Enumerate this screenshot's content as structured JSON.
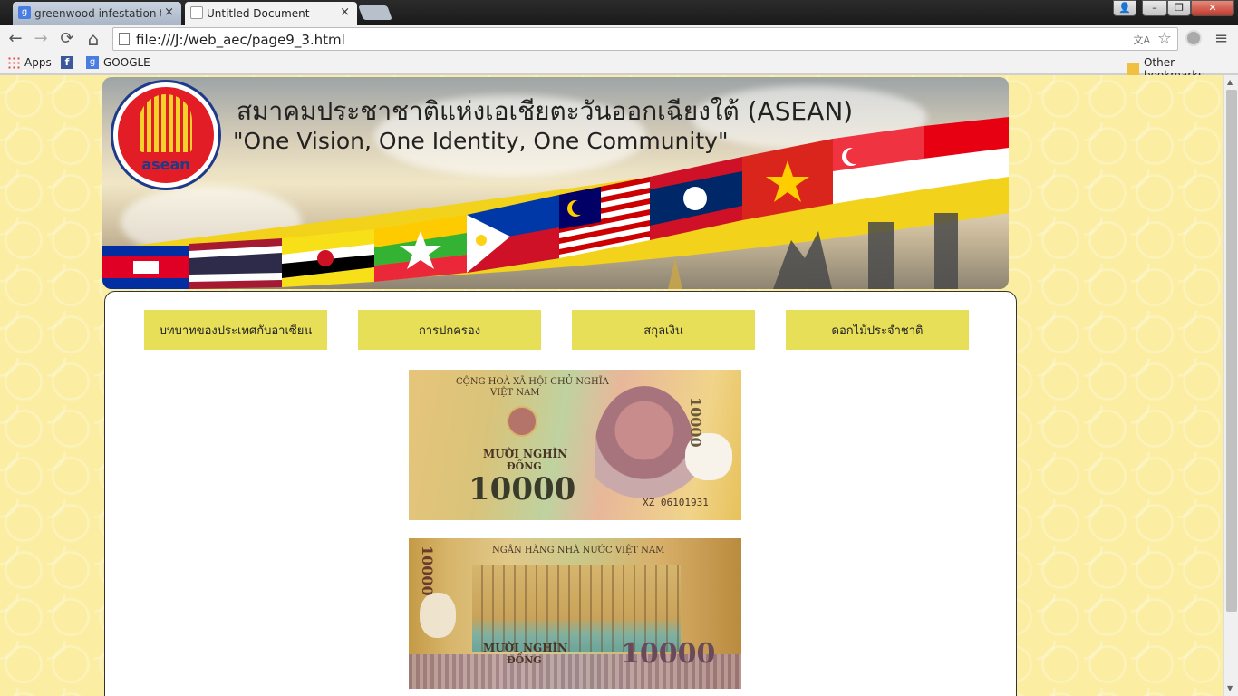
{
  "browser": {
    "tabs": [
      {
        "label": "greenwood infestation th",
        "active": false
      },
      {
        "label": "Untitled Document",
        "active": true
      }
    ],
    "close_glyph": "×",
    "url": "file:///J:/web_aec/page9_3.html",
    "bookmarks": [
      {
        "label": "Apps",
        "icon": "apps-icon"
      },
      {
        "label": "GOOGLE",
        "icon": "google-icon"
      }
    ],
    "other_bookmarks": "Other bookmarks",
    "icons": {
      "back": "←",
      "forward": "→",
      "reload": "⟳",
      "home": "⌂",
      "star": "☆",
      "menu": "≡"
    }
  },
  "banner": {
    "logo_word": "asean",
    "title": "สมาคมประชาชาติแห่งเอเชียตะวันออกเฉียงใต้ (ASEAN)",
    "slogan": "\"One Vision, One Identity, One Community\""
  },
  "menu": [
    {
      "label": "บทบาทของประเทศกับอาเซียน"
    },
    {
      "label": "การปกครอง"
    },
    {
      "label": "สกุลเงิน"
    },
    {
      "label": "ดอกไม้ประจำชาติ"
    }
  ],
  "banknote_front": {
    "header_1": "CỘNG HOÀ XÃ HỘI CHỦ NGHĨA",
    "header_2": "VIỆT NAM",
    "words_1": "MƯỜI NGHÌN",
    "words_2": "ĐỒNG",
    "value": "10000",
    "serial": "XZ 06101931"
  },
  "banknote_back": {
    "header": "NGÂN HÀNG NHÀ NƯỚC VIỆT NAM",
    "words_1": "MƯỜI NGHÌN",
    "words_2": "ĐỒNG",
    "value": "10000"
  },
  "colors": {
    "page_bg": "#fbeea2",
    "menu_button": "#e8df58",
    "logo_red": "#e31d25",
    "logo_blue": "#1e3a8a"
  }
}
